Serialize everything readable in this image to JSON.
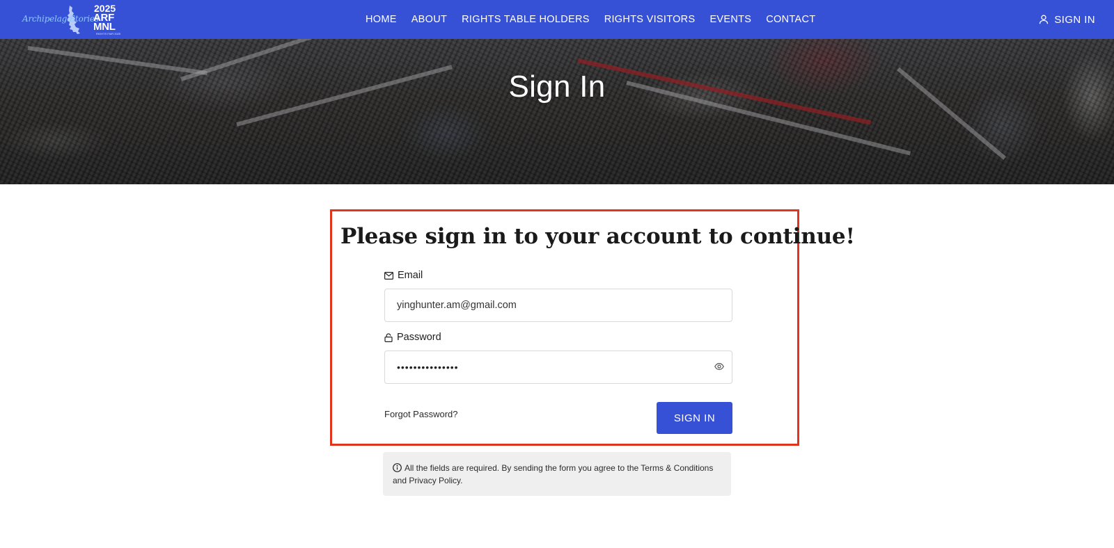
{
  "brand": {
    "script_word_1": "Archipelago",
    "script_word_2": "Stories",
    "year": "2025",
    "abbr_line_1": "ARF",
    "abbr_line_2": "MNL",
    "tagline": "RIGHTS FAIR 2025",
    "primary_color": "#3751d6"
  },
  "nav": {
    "links": [
      "HOME",
      "ABOUT",
      "RIGHTS TABLE HOLDERS",
      "RIGHTS VISITORS",
      "EVENTS",
      "CONTACT"
    ],
    "signin_label": "SIGN IN",
    "signin_icon": "user-icon"
  },
  "hero": {
    "title": "Sign In"
  },
  "form": {
    "heading": "Please sign in to your account to continue!",
    "email_label": "Email",
    "email_icon": "mail-icon",
    "email_value": "yinghunter.am@gmail.com",
    "password_label": "Password",
    "password_icon": "lock-icon",
    "password_masked": "•••••••••••••••",
    "toggle_icon": "eye-icon",
    "forgot_label": "Forgot Password?",
    "submit_label": "SIGN IN",
    "highlight_color": "#e0341c"
  },
  "notice": {
    "icon": "info-icon",
    "text": "All the fields are required. By sending the form you agree to the Terms & Conditions and Privacy Policy."
  }
}
